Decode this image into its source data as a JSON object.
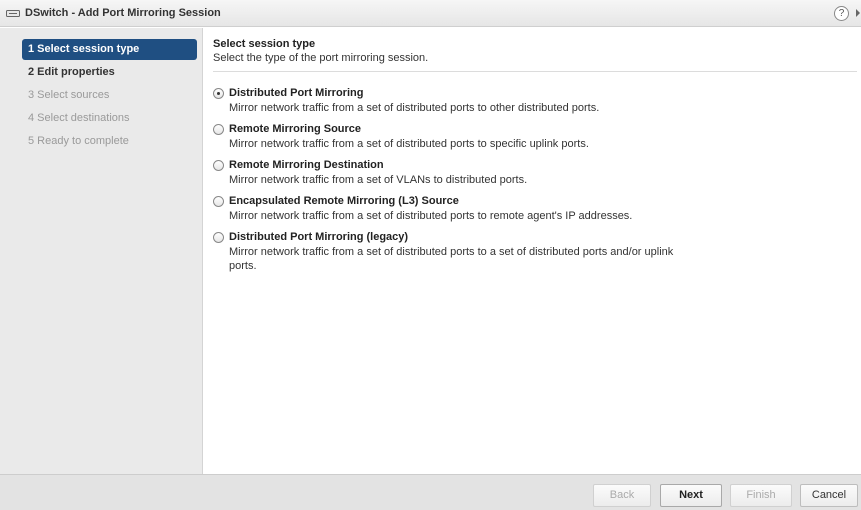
{
  "window": {
    "title": "DSwitch - Add Port Mirroring Session",
    "help_glyph": "?"
  },
  "sidebar": {
    "steps": [
      {
        "label": "1 Select session type",
        "state": "active"
      },
      {
        "label": "2 Edit properties",
        "state": "enabled"
      },
      {
        "label": "3 Select sources",
        "state": "disabled"
      },
      {
        "label": "4 Select destinations",
        "state": "disabled"
      },
      {
        "label": "5 Ready to complete",
        "state": "disabled"
      }
    ]
  },
  "main": {
    "heading": "Select session type",
    "subheading": "Select the type of the port mirroring session.",
    "options": [
      {
        "label": "Distributed Port Mirroring",
        "description": "Mirror network traffic from a set of distributed ports to other distributed ports.",
        "selected": true
      },
      {
        "label": "Remote Mirroring Source",
        "description": "Mirror network traffic from a set of distributed ports to specific uplink ports.",
        "selected": false
      },
      {
        "label": "Remote Mirroring Destination",
        "description": "Mirror network traffic from a set of VLANs to distributed ports.",
        "selected": false
      },
      {
        "label": "Encapsulated Remote Mirroring (L3) Source",
        "description": "Mirror network traffic from a set of distributed ports to remote agent's IP addresses.",
        "selected": false
      },
      {
        "label": "Distributed Port Mirroring (legacy)",
        "description": "Mirror network traffic from a set of distributed ports to a set of distributed ports and/or uplink ports.",
        "selected": false
      }
    ]
  },
  "footer": {
    "back_label": "Back",
    "next_label": "Next",
    "finish_label": "Finish",
    "cancel_label": "Cancel"
  },
  "colors": {
    "active_step_bg": "#1f4f82",
    "sidebar_bg": "#eaeaea",
    "footer_bg": "#e3e3e3"
  }
}
